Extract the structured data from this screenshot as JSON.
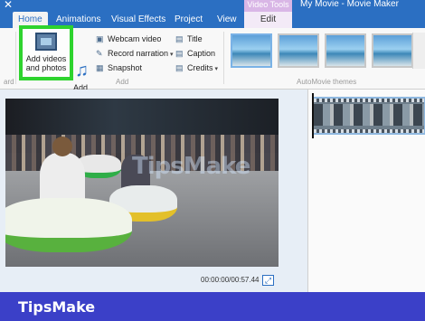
{
  "window": {
    "title": "My Movie - Movie Maker",
    "contextual_label": "Video Tools"
  },
  "tabs": [
    "Home",
    "Animations",
    "Visual Effects",
    "Project",
    "View",
    "Edit"
  ],
  "ribbon": {
    "add_videos_label": "Add videos\nand photos",
    "add_music_label": "Add\nmusic",
    "webcam": "Webcam video",
    "record_narration": "Record narration",
    "snapshot": "Snapshot",
    "title": "Title",
    "caption": "Caption",
    "credits": "Credits",
    "group_add": "Add",
    "group_themes": "AutoMovie themes",
    "group_left_fragment": "ard"
  },
  "preview": {
    "watermark": "TipsMake",
    "timecode": "00:00:00/00:57.44"
  },
  "footer": {
    "brand": "TipsMake"
  }
}
